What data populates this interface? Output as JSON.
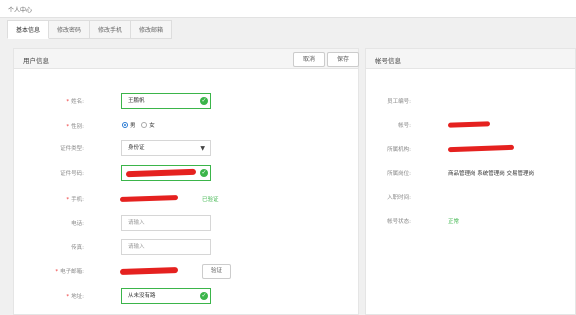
{
  "header": {
    "title": "个人中心"
  },
  "tabs": [
    {
      "label": "基本信息",
      "active": true
    },
    {
      "label": "修改密码",
      "active": false
    },
    {
      "label": "修改手机",
      "active": false
    },
    {
      "label": "修改邮箱",
      "active": false
    }
  ],
  "user_panel": {
    "title": "用户信息",
    "cancel_label": "取消",
    "save_label": "保存",
    "fields": {
      "name": {
        "label": "姓名:",
        "value": "王鹏帆"
      },
      "gender": {
        "label": "性别:",
        "options": [
          "男",
          "女"
        ],
        "selected": "男"
      },
      "id_type": {
        "label": "证件类型:",
        "value": "身份证"
      },
      "id_number": {
        "label": "证件号码:"
      },
      "mobile": {
        "label": "手机:",
        "status": "已验证"
      },
      "phone": {
        "label": "电话:",
        "placeholder": "请输入"
      },
      "fax": {
        "label": "传真:",
        "placeholder": "请输入"
      },
      "email": {
        "label": "电子邮箱:",
        "verify_label": "验证"
      },
      "address": {
        "label": "地址:",
        "value": "从未没有路"
      }
    }
  },
  "account_panel": {
    "title": "帐号信息",
    "rows": [
      {
        "label": "员工编号:",
        "value": ""
      },
      {
        "label": "帐号:",
        "value": ""
      },
      {
        "label": "所属机构:",
        "value": ""
      },
      {
        "label": "所属岗位:",
        "value": "商品管理岗 系统管理岗 交易管理岗"
      },
      {
        "label": "入职时间:",
        "value": ""
      },
      {
        "label": "帐号状态:",
        "value": "正常"
      }
    ]
  },
  "colors": {
    "success": "#3bb54a",
    "required": "#e33333",
    "redaction": "#e5211f",
    "accent": "#2b7bd3"
  },
  "icons": [
    "check-circle-icon",
    "caret-down-icon"
  ]
}
